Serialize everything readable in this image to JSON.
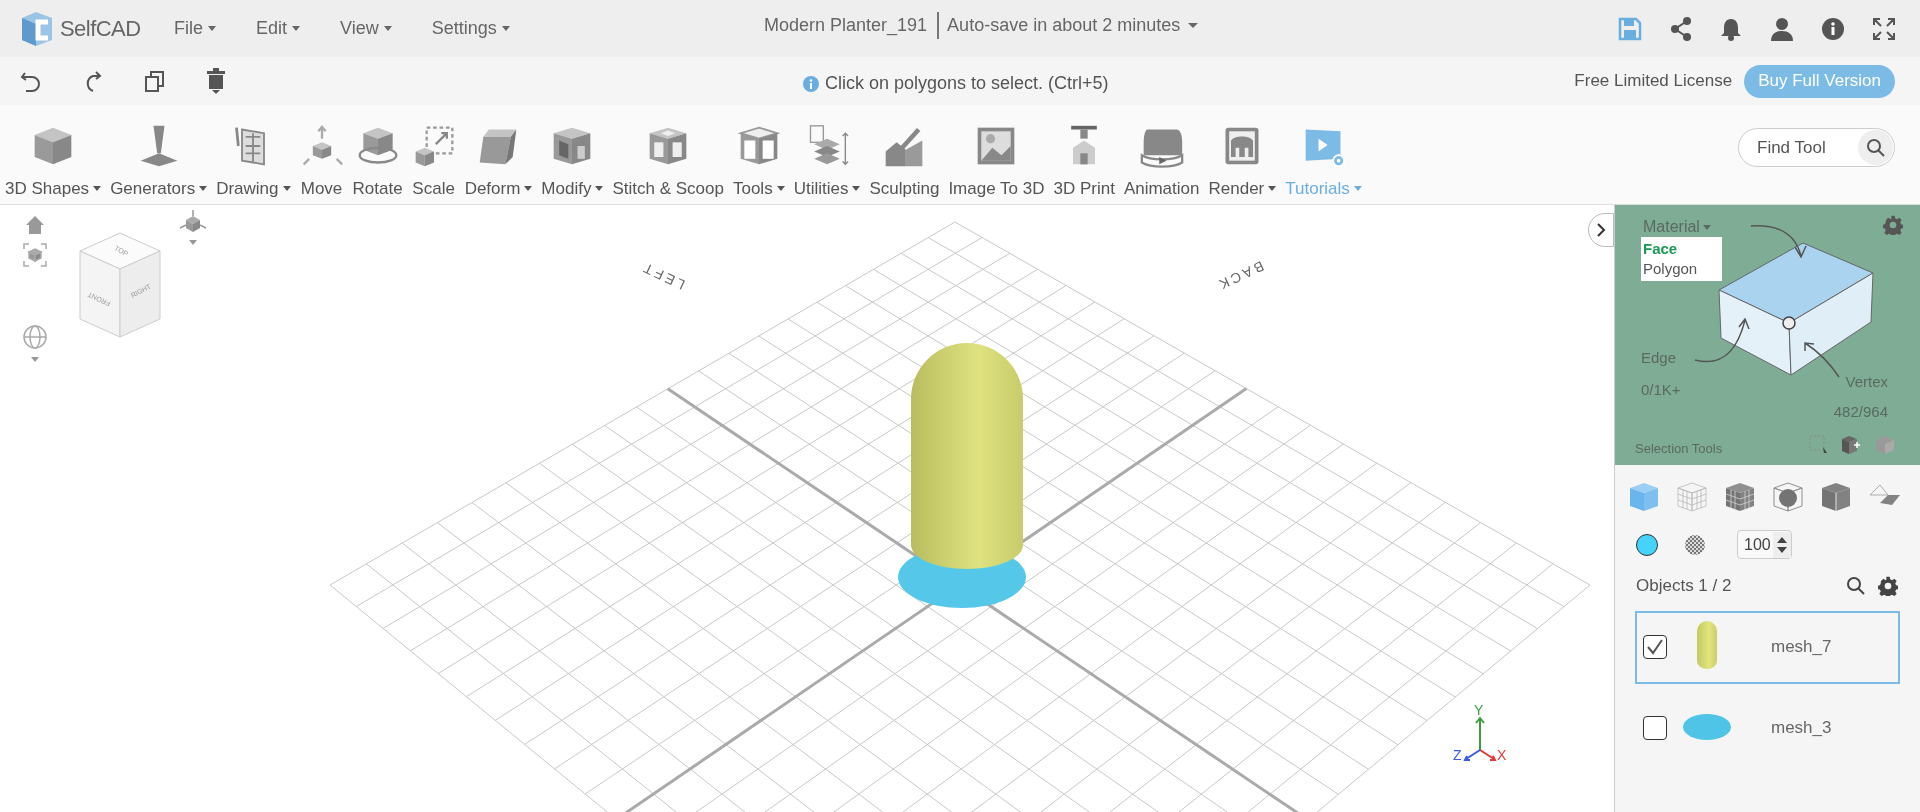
{
  "app": {
    "logo": "SelfCAD"
  },
  "menu": [
    {
      "label": "File"
    },
    {
      "label": "Edit"
    },
    {
      "label": "View"
    },
    {
      "label": "Settings"
    }
  ],
  "document": {
    "title": "Modern Planter_191",
    "autosave": "Auto-save in about 2 minutes"
  },
  "action_bar": {
    "hint": "Click on polygons to select. (Ctrl+5)",
    "license": "Free Limited License",
    "buy_button": "Buy Full Version"
  },
  "toolbar": {
    "tools": [
      {
        "label": "3D Shapes",
        "kind": "shapes",
        "dropdown": true,
        "highlighted": false
      },
      {
        "label": "Generators",
        "kind": "generators",
        "dropdown": true,
        "highlighted": false
      },
      {
        "label": "Drawing",
        "kind": "drawing",
        "dropdown": true,
        "highlighted": false
      },
      {
        "label": "Move",
        "kind": "move",
        "dropdown": false,
        "highlighted": false
      },
      {
        "label": "Rotate",
        "kind": "rotate",
        "dropdown": false,
        "highlighted": false
      },
      {
        "label": "Scale",
        "kind": "scale",
        "dropdown": false,
        "highlighted": false
      },
      {
        "label": "Deform",
        "kind": "deform",
        "dropdown": true,
        "highlighted": false
      },
      {
        "label": "Modify",
        "kind": "modify",
        "dropdown": true,
        "highlighted": false
      },
      {
        "label": "Stitch & Scoop",
        "kind": "stitch",
        "dropdown": false,
        "highlighted": false
      },
      {
        "label": "Tools",
        "kind": "tools",
        "dropdown": true,
        "highlighted": false
      },
      {
        "label": "Utilities",
        "kind": "utilities",
        "dropdown": true,
        "highlighted": false
      },
      {
        "label": "Sculpting",
        "kind": "sculpting",
        "dropdown": false,
        "highlighted": false
      },
      {
        "label": "Image To 3D",
        "kind": "image",
        "dropdown": false,
        "highlighted": false
      },
      {
        "label": "3D Print",
        "kind": "print",
        "dropdown": false,
        "highlighted": false
      },
      {
        "label": "Animation",
        "kind": "animation",
        "dropdown": false,
        "highlighted": false
      },
      {
        "label": "Render",
        "kind": "render",
        "dropdown": true,
        "highlighted": false
      },
      {
        "label": "Tutorials",
        "kind": "tutorials",
        "dropdown": true,
        "highlighted": true
      }
    ],
    "search": {
      "placeholder": "Find Tool"
    }
  },
  "viewport": {
    "axis_labels": [
      "LEFT",
      "BACK"
    ],
    "view_cube": {
      "top": "TOP",
      "front": "FRONT",
      "right": "RIGHT"
    },
    "gizmo": {
      "x": "X",
      "y": "Y",
      "z": "Z"
    }
  },
  "selection_panel": {
    "material": "Material",
    "modes": [
      {
        "label": "Face",
        "selected": true
      },
      {
        "label": "Polygon",
        "selected": false
      }
    ],
    "edge": "Edge",
    "edge_count": "0/1K+",
    "vertex": "Vertex",
    "vertex_count": "482/964",
    "title": "Selection Tools"
  },
  "display_modes": [
    {
      "kind": "solid",
      "selected": true
    },
    {
      "kind": "wireframe",
      "selected": false
    },
    {
      "kind": "solid-wire",
      "selected": false
    },
    {
      "kind": "xray",
      "selected": false
    },
    {
      "kind": "flat",
      "selected": false
    },
    {
      "kind": "plane",
      "selected": false
    }
  ],
  "opacity": {
    "value": "100"
  },
  "objects": {
    "title": "Objects 1 / 2",
    "items": [
      {
        "name": "mesh_7",
        "kind": "capsule",
        "checked": true,
        "selected": true
      },
      {
        "name": "mesh_3",
        "kind": "disc",
        "checked": false,
        "selected": false
      }
    ]
  }
}
